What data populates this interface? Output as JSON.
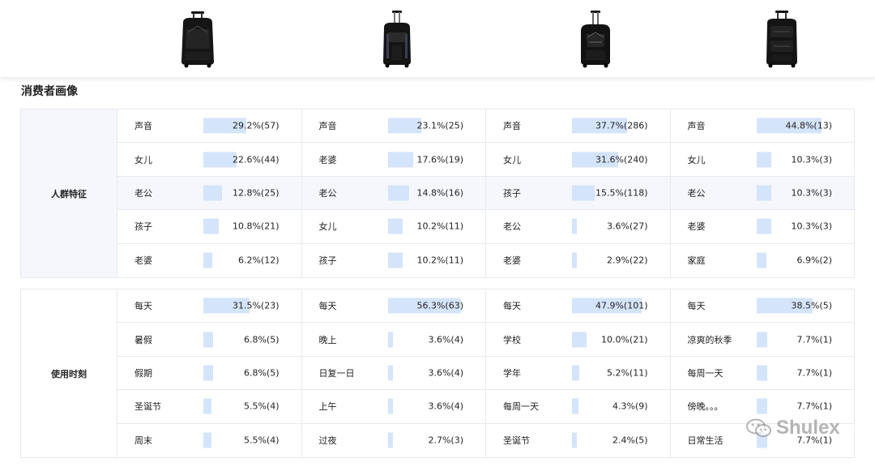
{
  "section_title": "消费者画像",
  "products": [
    {
      "name": "backpack-1",
      "icon": "rolling-backpack-icon"
    },
    {
      "name": "backpack-2",
      "icon": "rolling-backpack-icon"
    },
    {
      "name": "backpack-3",
      "icon": "rolling-backpack-icon"
    },
    {
      "name": "backpack-4",
      "icon": "rolling-backpack-icon"
    }
  ],
  "colors": {
    "bar_fill": "#d4e4fb",
    "tint": "#f5f7fc",
    "border": "#e6e9ef"
  },
  "groups": [
    {
      "label": "人群特征",
      "columns": [
        [
          {
            "term": "声音",
            "value": "29.2%(57)",
            "pct": 29.2
          },
          {
            "term": "女儿",
            "value": "22.6%(44)",
            "pct": 22.6
          },
          {
            "term": "老公",
            "value": "12.8%(25)",
            "pct": 12.8
          },
          {
            "term": "孩子",
            "value": "10.8%(21)",
            "pct": 10.8
          },
          {
            "term": "老婆",
            "value": "6.2%(12)",
            "pct": 6.2
          }
        ],
        [
          {
            "term": "声音",
            "value": "23.1%(25)",
            "pct": 23.1
          },
          {
            "term": "老婆",
            "value": "17.6%(19)",
            "pct": 17.6
          },
          {
            "term": "老公",
            "value": "14.8%(16)",
            "pct": 14.8
          },
          {
            "term": "女儿",
            "value": "10.2%(11)",
            "pct": 10.2
          },
          {
            "term": "孩子",
            "value": "10.2%(11)",
            "pct": 10.2
          }
        ],
        [
          {
            "term": "声音",
            "value": "37.7%(286)",
            "pct": 37.7
          },
          {
            "term": "女儿",
            "value": "31.6%(240)",
            "pct": 31.6
          },
          {
            "term": "孩子",
            "value": "15.5%(118)",
            "pct": 15.5
          },
          {
            "term": "老公",
            "value": "3.6%(27)",
            "pct": 3.6
          },
          {
            "term": "老婆",
            "value": "2.9%(22)",
            "pct": 2.9
          }
        ],
        [
          {
            "term": "声音",
            "value": "44.8%(13)",
            "pct": 44.8
          },
          {
            "term": "女儿",
            "value": "10.3%(3)",
            "pct": 10.3
          },
          {
            "term": "老公",
            "value": "10.3%(3)",
            "pct": 10.3
          },
          {
            "term": "老婆",
            "value": "10.3%(3)",
            "pct": 10.3
          },
          {
            "term": "家庭",
            "value": "6.9%(2)",
            "pct": 6.9
          }
        ]
      ]
    },
    {
      "label": "使用时刻",
      "columns": [
        [
          {
            "term": "每天",
            "value": "31.5%(23)",
            "pct": 31.5
          },
          {
            "term": "暑假",
            "value": "6.8%(5)",
            "pct": 6.8
          },
          {
            "term": "假期",
            "value": "6.8%(5)",
            "pct": 6.8
          },
          {
            "term": "圣诞节",
            "value": "5.5%(4)",
            "pct": 5.5
          },
          {
            "term": "周末",
            "value": "5.5%(4)",
            "pct": 5.5
          }
        ],
        [
          {
            "term": "每天",
            "value": "56.3%(63)",
            "pct": 56.3
          },
          {
            "term": "晚上",
            "value": "3.6%(4)",
            "pct": 3.6
          },
          {
            "term": "日复一日",
            "value": "3.6%(4)",
            "pct": 3.6
          },
          {
            "term": "上午",
            "value": "3.6%(4)",
            "pct": 3.6
          },
          {
            "term": "过夜",
            "value": "2.7%(3)",
            "pct": 2.7
          }
        ],
        [
          {
            "term": "每天",
            "value": "47.9%(101)",
            "pct": 47.9
          },
          {
            "term": "学校",
            "value": "10.0%(21)",
            "pct": 10.0
          },
          {
            "term": "学年",
            "value": "5.2%(11)",
            "pct": 5.2
          },
          {
            "term": "每周一天",
            "value": "4.3%(9)",
            "pct": 4.3
          },
          {
            "term": "圣诞节",
            "value": "2.4%(5)",
            "pct": 2.4
          }
        ],
        [
          {
            "term": "每天",
            "value": "38.5%(5)",
            "pct": 38.5
          },
          {
            "term": "凉爽的秋季",
            "value": "7.7%(1)",
            "pct": 7.7
          },
          {
            "term": "每周一天",
            "value": "7.7%(1)",
            "pct": 7.7
          },
          {
            "term": "傍晚。。。",
            "value": "7.7%(1)",
            "pct": 7.7
          },
          {
            "term": "日常生活",
            "value": "7.7%(1)",
            "pct": 7.7
          }
        ]
      ]
    }
  ],
  "watermark": {
    "text": "Shulex",
    "icon": "wechat-icon"
  }
}
